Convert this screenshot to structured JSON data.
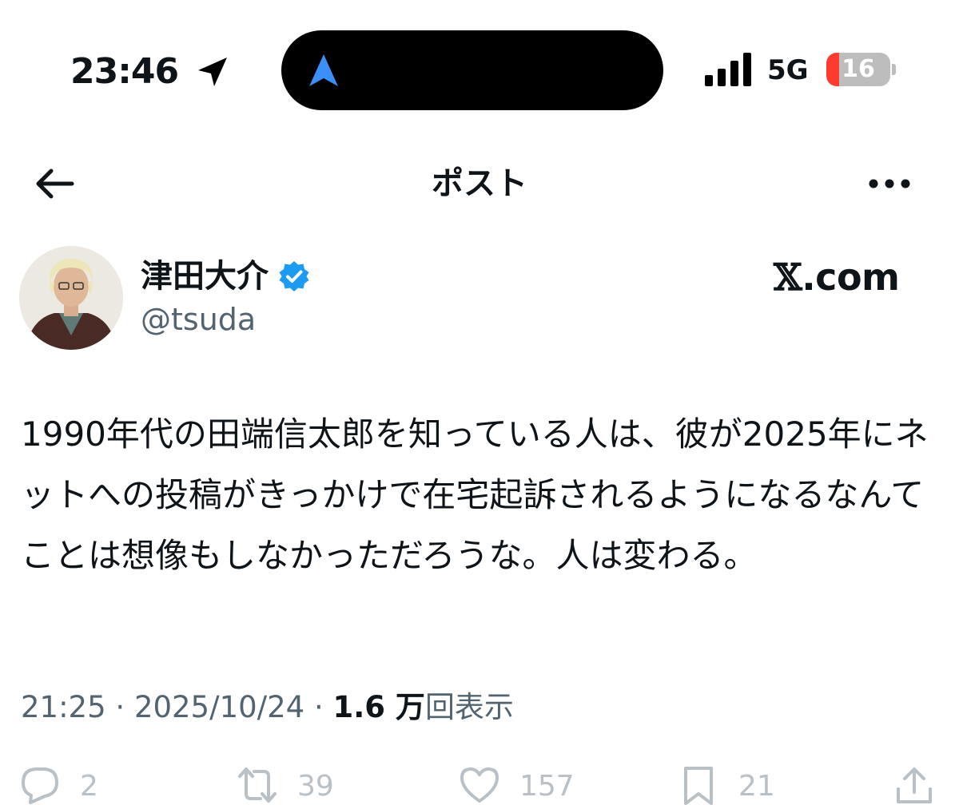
{
  "status_bar": {
    "time": "23:46",
    "network": "5G",
    "battery_level": "16",
    "battery_color": "#ff3b30"
  },
  "header": {
    "title": "ポスト",
    "back_icon": "arrow-left-icon",
    "more_icon": "more-horizontal-icon"
  },
  "author": {
    "display_name": "津田大介",
    "handle": "@tsuda",
    "verified": true,
    "verified_color": "#1d9bf0"
  },
  "watermark": {
    "x_glyph": "𝕏",
    "domain": ".com"
  },
  "post": {
    "text": "1990年代の田端信太郎を知っている人は、彼が2025年にネットへの投稿がきっかけで在宅起訴されるようになるなんてことは想像もしなかっただろうな。人は変わる。",
    "time": "21:25",
    "separator": "·",
    "date": "2025/10/24",
    "views_count": "1.6 万",
    "views_label": "回表示"
  },
  "actions": {
    "reply_count": "2",
    "repost_count": "39",
    "like_count": "157",
    "bookmark_count": "21"
  },
  "colors": {
    "text_primary": "#0f1419",
    "text_secondary": "#536471",
    "action_muted": "#b9c0c6",
    "accent": "#1d9bf0"
  }
}
